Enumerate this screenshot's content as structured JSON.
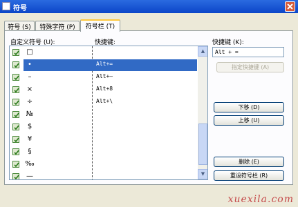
{
  "window": {
    "title": "符号"
  },
  "tabs": [
    {
      "label": "符号 (S)"
    },
    {
      "label": "特殊字符 (P)"
    },
    {
      "label": "符号栏 (T)"
    }
  ],
  "list": {
    "header_symbol": "自定义符号 (U):",
    "header_shortcut": "快捷键:",
    "items": [
      {
        "symbol": "□",
        "shortcut": ""
      },
      {
        "symbol": "•",
        "shortcut": "Alt+="
      },
      {
        "symbol": "–",
        "shortcut": "Alt+–"
      },
      {
        "symbol": "×",
        "shortcut": "Alt+8"
      },
      {
        "symbol": "÷",
        "shortcut": "Alt+\\"
      },
      {
        "symbol": "№",
        "shortcut": ""
      },
      {
        "symbol": "$",
        "shortcut": ""
      },
      {
        "symbol": "¥",
        "shortcut": ""
      },
      {
        "symbol": "§",
        "shortcut": ""
      },
      {
        "symbol": "‰",
        "shortcut": ""
      },
      {
        "symbol": "—",
        "shortcut": ""
      }
    ],
    "selected_index": 1
  },
  "shortcut_panel": {
    "label": "快捷键 (K):",
    "value": "Alt + =",
    "assign_button": "指定快捷键 (A)"
  },
  "buttons": {
    "move_down": "下移 (D)",
    "move_up": "上移 (U)",
    "delete": "删除 (E)",
    "reset": "重设符号栏 (R)"
  },
  "watermark": "xuexila.com",
  "colors": {
    "selection": "#316ac5",
    "titlebar": "#0c46c8",
    "tab_highlight": "#ffc83c"
  }
}
